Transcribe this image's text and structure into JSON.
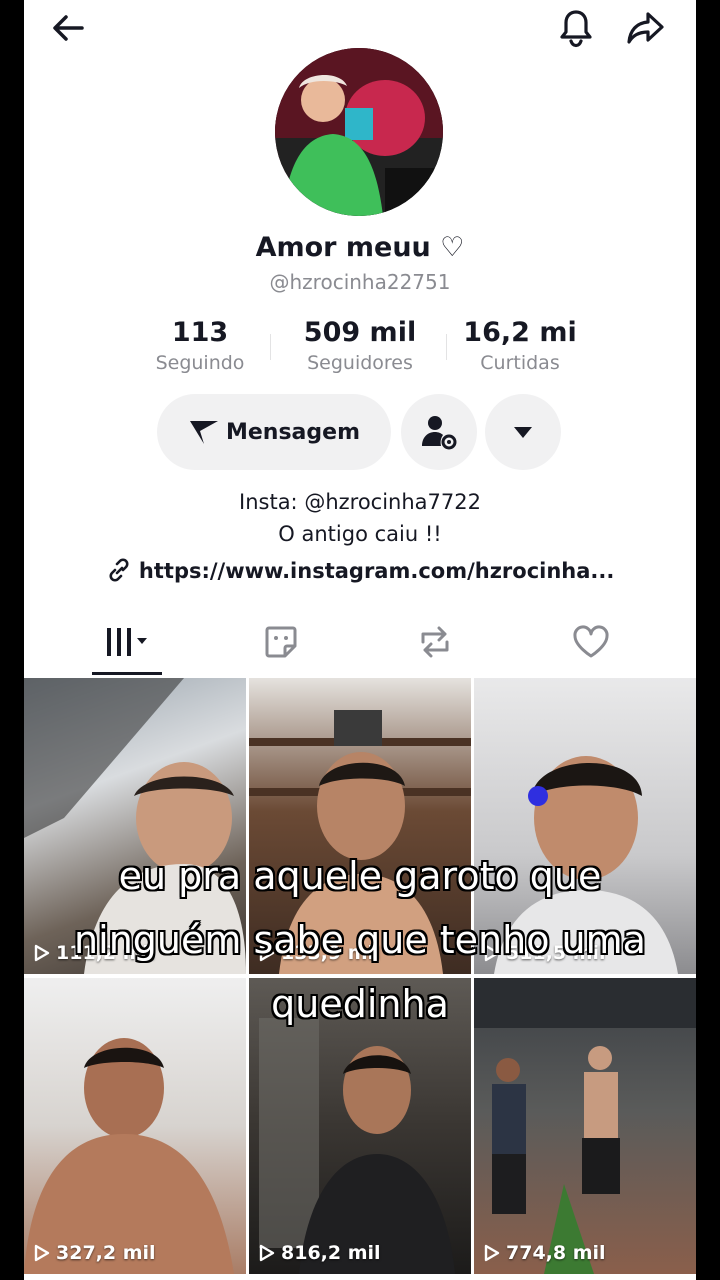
{
  "profile": {
    "display_name": "Amor meuu ♡",
    "username": "@hzrocinha22751"
  },
  "stats": [
    {
      "value": "113",
      "label": "Seguindo"
    },
    {
      "value": "509 mil",
      "label": "Seguidores"
    },
    {
      "value": "16,2 mi",
      "label": "Curtidas"
    }
  ],
  "actions": {
    "message_label": "Mensagem"
  },
  "bio": {
    "line1": "Insta: @hzrocinha7722",
    "line2": "O antigo caiu !!",
    "link": "https://www.instagram.com/hzrocinha..."
  },
  "videos": [
    {
      "views": "111,2 mil"
    },
    {
      "views": "133,9 mil"
    },
    {
      "views": "511,5 mil"
    },
    {
      "views": "327,2 mil"
    },
    {
      "views": "816,2 mil"
    },
    {
      "views": "774,8 mil"
    }
  ],
  "overlay_caption": "eu pra aquele garoto que\nninguém sabe que tenho uma\nquedinha",
  "colors": {
    "text_primary": "#161823",
    "text_secondary": "#8a8b91",
    "button_bg": "#f1f1f2"
  }
}
